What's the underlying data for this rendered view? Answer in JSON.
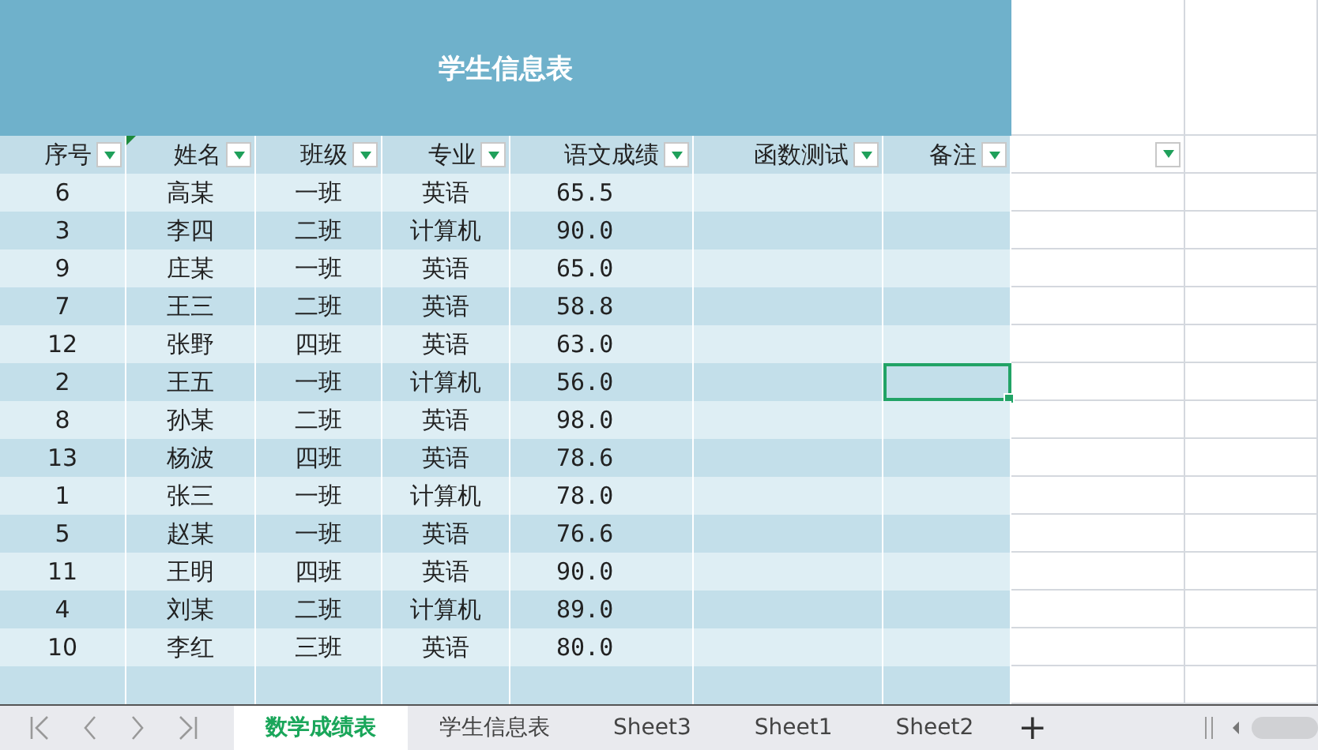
{
  "title": "学生信息表",
  "columns": [
    {
      "label": "序号",
      "filter": true
    },
    {
      "label": "姓名",
      "filter": true
    },
    {
      "label": "班级",
      "filter": true
    },
    {
      "label": "专业",
      "filter": true
    },
    {
      "label": "语文成绩",
      "filter": true
    },
    {
      "label": "函数测试",
      "filter": true
    },
    {
      "label": "备注",
      "filter": true
    }
  ],
  "extra_column_filter": true,
  "rows": [
    {
      "cells": [
        "6",
        "高某",
        "一班",
        "英语",
        "65.5"
      ],
      "selected": false
    },
    {
      "cells": [
        "3",
        "李四",
        "二班",
        "计算机",
        "90.0"
      ],
      "selected": false
    },
    {
      "cells": [
        "9",
        "庄某",
        "一班",
        "英语",
        "65.0"
      ],
      "selected": false
    },
    {
      "cells": [
        "7",
        "王三",
        "二班",
        "英语",
        "58.8"
      ],
      "selected": false
    },
    {
      "cells": [
        "12",
        "张野",
        "四班",
        "英语",
        "63.0"
      ],
      "selected": false
    },
    {
      "cells": [
        "2",
        "王五",
        "一班",
        "计算机",
        "56.0"
      ],
      "selected": true
    },
    {
      "cells": [
        "8",
        "孙某",
        "二班",
        "英语",
        "98.0"
      ],
      "selected": false
    },
    {
      "cells": [
        "13",
        "杨波",
        "四班",
        "英语",
        "78.6"
      ],
      "selected": false
    },
    {
      "cells": [
        "1",
        "张三",
        "一班",
        "计算机",
        "78.0"
      ],
      "selected": false
    },
    {
      "cells": [
        "5",
        "赵某",
        "一班",
        "英语",
        "76.6"
      ],
      "selected": false
    },
    {
      "cells": [
        "11",
        "王明",
        "四班",
        "英语",
        "90.0"
      ],
      "selected": false
    },
    {
      "cells": [
        "4",
        "刘某",
        "二班",
        "计算机",
        "89.0"
      ],
      "selected": false
    },
    {
      "cells": [
        "10",
        "李红",
        "三班",
        "英语",
        "80.0"
      ],
      "selected": false
    }
  ],
  "sheet_tabs": [
    {
      "label": "数学成绩表",
      "selected": true
    },
    {
      "label": "学生信息表",
      "selected": false
    },
    {
      "label": "Sheet3",
      "selected": false
    },
    {
      "label": "Sheet1",
      "selected": false
    },
    {
      "label": "Sheet2",
      "selected": false
    }
  ],
  "add_sheet": "+"
}
